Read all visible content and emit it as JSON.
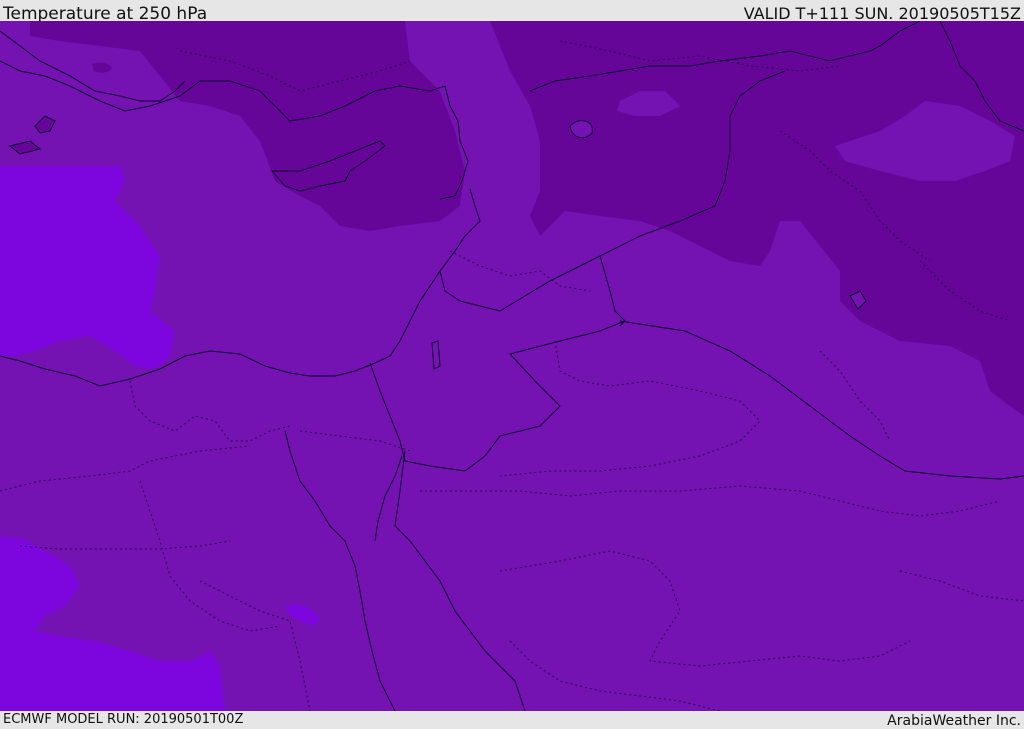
{
  "header": {
    "title": "Temperature at 250 hPa",
    "valid": "VALID T+111 SUN. 20190505T15Z"
  },
  "footer": {
    "model_run": "ECMWF MODEL RUN: 20190501T00Z",
    "credit": "ArabiaWeather Inc."
  },
  "colors": {
    "base_field": "#7412b2",
    "cold_zone": "#650699",
    "warm_zone": "#7c06dd",
    "border_line": "#0d0030",
    "province_line": "#280650"
  }
}
